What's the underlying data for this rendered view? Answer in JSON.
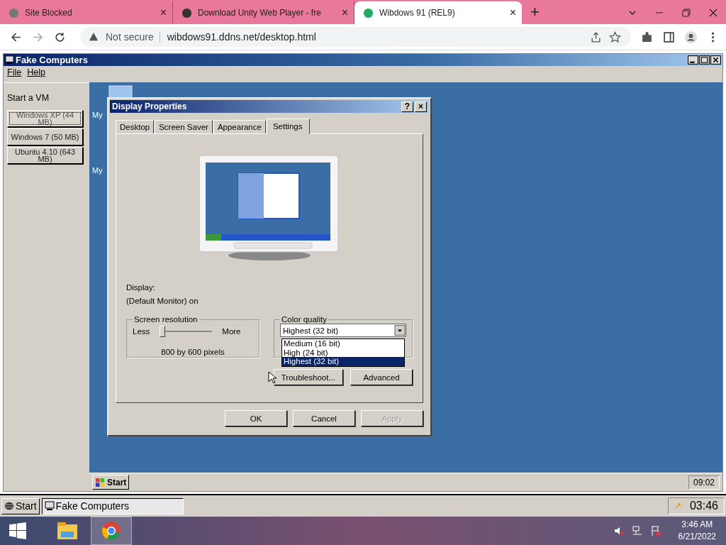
{
  "browser": {
    "tabs": [
      {
        "title": "Site Blocked",
        "selected": false,
        "close": "×"
      },
      {
        "title": "Download Unity Web Player - fre",
        "selected": false,
        "close": "×"
      },
      {
        "title": "Wibdows 91 (REL9)",
        "selected": true,
        "close": "×"
      }
    ],
    "new_tab": "+",
    "security": "Not secure",
    "url": "wibdows91.ddns.net/desktop.html"
  },
  "app_window": {
    "title": "Fake Computers",
    "menu": [
      "File",
      "Help"
    ],
    "sidebar": {
      "heading": "Start a VM",
      "vms": [
        {
          "label": "Windows XP (44 MB)",
          "focused": true
        },
        {
          "label": "Windows 7 (50 MB)",
          "focused": false
        },
        {
          "label": "Ubuntu 4.10 (643 MB)",
          "focused": false
        }
      ]
    },
    "desktop_icons": [
      {
        "label": "My"
      },
      {
        "label": "My"
      }
    ],
    "dialog": {
      "title": "Display Properties",
      "help": "?",
      "close": "×",
      "tabs": [
        {
          "label": "Desktop",
          "selected": false
        },
        {
          "label": "Screen Saver",
          "selected": false
        },
        {
          "label": "Appearance",
          "selected": false
        },
        {
          "label": "Settings",
          "selected": true
        }
      ],
      "display_label": "Display:",
      "monitor": "(Default Monitor) on",
      "resolution": {
        "title": "Screen resolution",
        "less": "Less",
        "more": "More",
        "level": 0,
        "reading": "800 by 600 pixels"
      },
      "color_quality": {
        "title": "Color quality",
        "value": "Highest (32 bit)",
        "options": [
          {
            "label": "Medium (16 bit)",
            "selected": false
          },
          {
            "label": "High (24 bit)",
            "selected": false
          },
          {
            "label": "Highest (32 bit)",
            "selected": true
          }
        ]
      },
      "panel_buttons": [
        "Troubleshoot...",
        "Advanced"
      ],
      "footer_buttons": [
        {
          "label": "OK",
          "disabled": false
        },
        {
          "label": "Cancel",
          "disabled": false
        },
        {
          "label": "Apply",
          "disabled": true
        }
      ]
    },
    "taskbar": {
      "start": "Start",
      "clock": "09:02"
    }
  },
  "outer_taskbar": {
    "start": "Start",
    "items": [
      "Fake Computers"
    ],
    "clock": "03:46"
  },
  "os_taskbar": {
    "time": "3:46 AM",
    "date": "6/21/2022"
  }
}
